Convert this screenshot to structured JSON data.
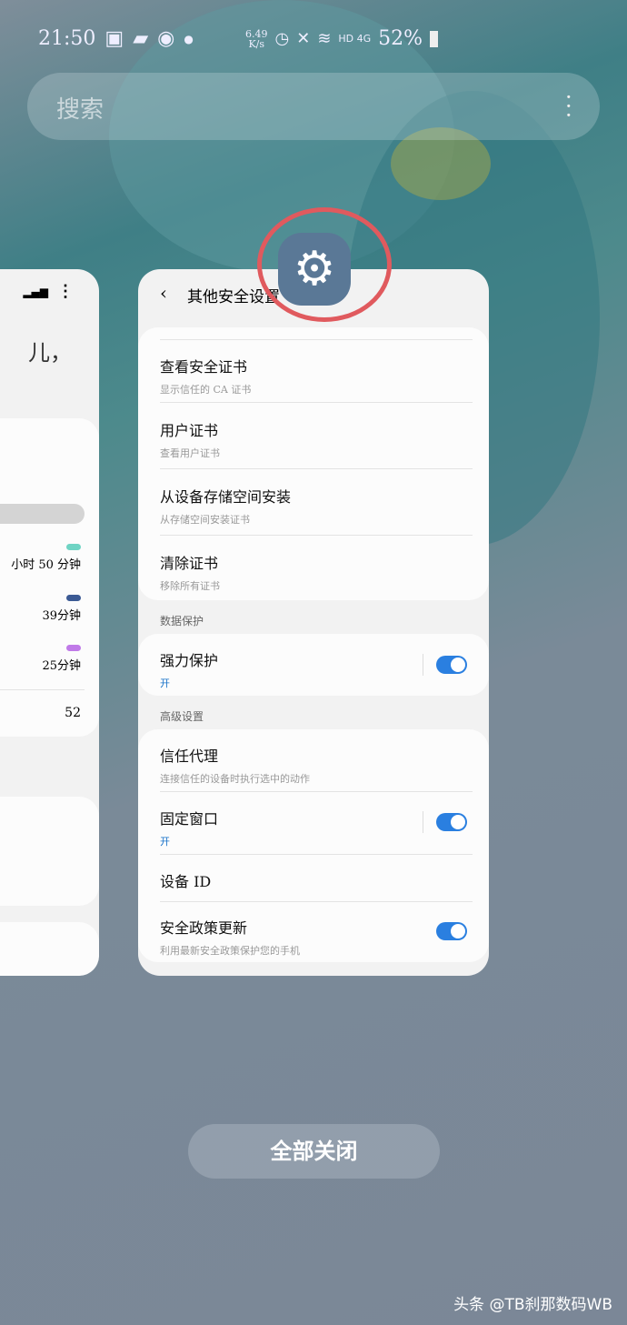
{
  "status": {
    "time": "21:50",
    "speed_top": "6.49",
    "speed_bottom": "K/s",
    "network": "HD 4G",
    "battery": "52%"
  },
  "search": {
    "placeholder": "搜索"
  },
  "left_card": {
    "greeting_fragment": "儿，",
    "usage": [
      {
        "value": "小时 50 分钟",
        "color": "#6fd4c4"
      },
      {
        "value": "39分钟",
        "color": "#3b5a94"
      },
      {
        "value": "25分钟",
        "color": "#c07ae8"
      }
    ],
    "count": "52"
  },
  "main_card": {
    "title": "其他安全设置",
    "certs": [
      {
        "title": "查看安全证书",
        "sub": "显示信任的 CA 证书"
      },
      {
        "title": "用户证书",
        "sub": "查看用户证书"
      },
      {
        "title": "从设备存储空间安装",
        "sub": "从存储空间安装证书"
      },
      {
        "title": "清除证书",
        "sub": "移除所有证书"
      }
    ],
    "data_section": "数据保护",
    "strong": {
      "title": "强力保护",
      "sub": "开",
      "on": true
    },
    "adv_section": "高级设置",
    "trust": {
      "title": "信任代理",
      "sub": "连接信任的设备时执行选中的动作"
    },
    "pin": {
      "title": "固定窗口",
      "sub": "开",
      "on": true
    },
    "device_id": {
      "title": "设备 ID"
    },
    "policy": {
      "title": "安全政策更新",
      "sub": "利用最新安全政策保护您的手机",
      "on": true
    }
  },
  "close_all": "全部关闭",
  "watermark": "头条 @TB刹那数码WB"
}
